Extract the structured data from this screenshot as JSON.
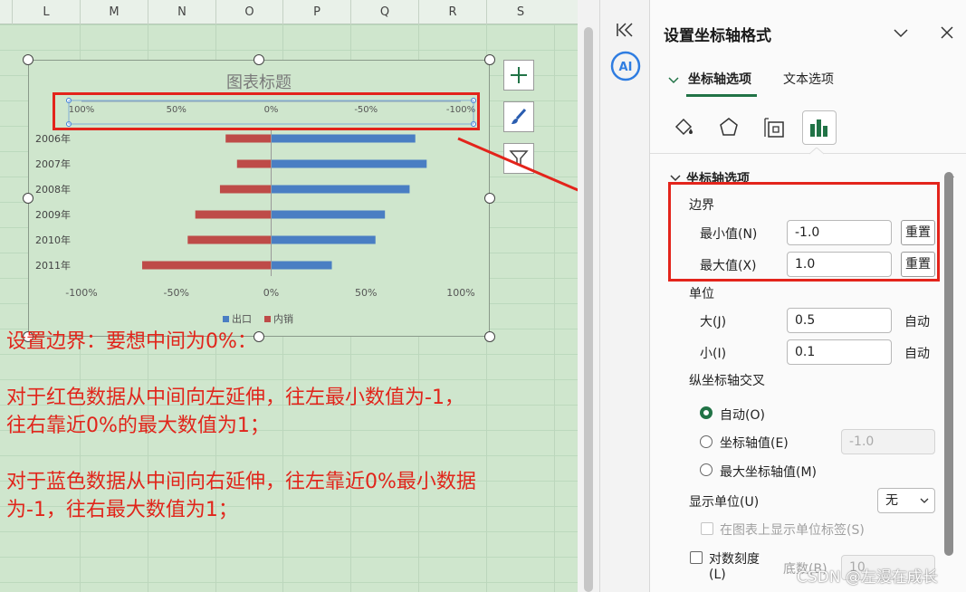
{
  "sheet": {
    "columns": [
      "L",
      "M",
      "N",
      "O",
      "P",
      "Q",
      "R",
      "S"
    ]
  },
  "chart": {
    "title": "图表标题",
    "side_buttons": [
      "plus-icon",
      "brush-icon",
      "filter-icon"
    ]
  },
  "chart_data": {
    "type": "bar",
    "orientation": "horizontal",
    "title": "图表标题",
    "categories": [
      "2006年",
      "2007年",
      "2008年",
      "2009年",
      "2010年",
      "2011年"
    ],
    "series": [
      {
        "name": "出口",
        "color": "#4a7ec3",
        "values": [
          0.76,
          0.82,
          0.73,
          0.6,
          0.55,
          0.32
        ]
      },
      {
        "name": "内销",
        "color": "#be4b48",
        "values": [
          -0.24,
          -0.18,
          -0.27,
          -0.4,
          -0.44,
          -0.68
        ]
      }
    ],
    "xlim": [
      -1,
      1
    ],
    "x_ticks_bottom": [
      "-100%",
      "-50%",
      "0%",
      "50%",
      "100%"
    ],
    "x_ticks_top": [
      "100%",
      "50%",
      "0%",
      "-50%",
      "-100%"
    ],
    "grid": false,
    "legend": "bottom"
  },
  "note": {
    "line1": "设置边界：要想中间为0%：",
    "line2": "对于红色数据从中间向左延伸，往左最小数值为-1，",
    "line3": "往右靠近0%的最大数值为1；",
    "line4": "对于蓝色数据从中间向右延伸，往左靠近0%最小数据",
    "line5": "为-1，往右最大数值为1；"
  },
  "panel": {
    "title": "设置坐标轴格式",
    "tabs": [
      "坐标轴选项",
      "文本选项"
    ],
    "section": "坐标轴选项",
    "bounds": {
      "label": "边界",
      "min_label": "最小值(N)",
      "min_value": "-1.0",
      "max_label": "最大值(X)",
      "max_value": "1.0",
      "reset": "重置"
    },
    "units": {
      "label": "单位",
      "major_label": "大(J)",
      "major_value": "0.5",
      "minor_label": "小(I)",
      "minor_value": "0.1",
      "auto": "自动"
    },
    "cross": {
      "label": "纵坐标轴交叉",
      "opt_auto": "自动(O)",
      "opt_value": "坐标轴值(E)",
      "opt_value_input": "-1.0",
      "opt_max": "最大坐标轴值(M)"
    },
    "display_units": {
      "label": "显示单位(U)",
      "value": "无",
      "show_label": "在图表上显示单位标签(S)"
    },
    "log": {
      "label": "对数刻度",
      "label2": "(L)",
      "base_label": "底数(B)",
      "base_value": "10"
    }
  },
  "watermark": "CSDN @左漫在成长"
}
